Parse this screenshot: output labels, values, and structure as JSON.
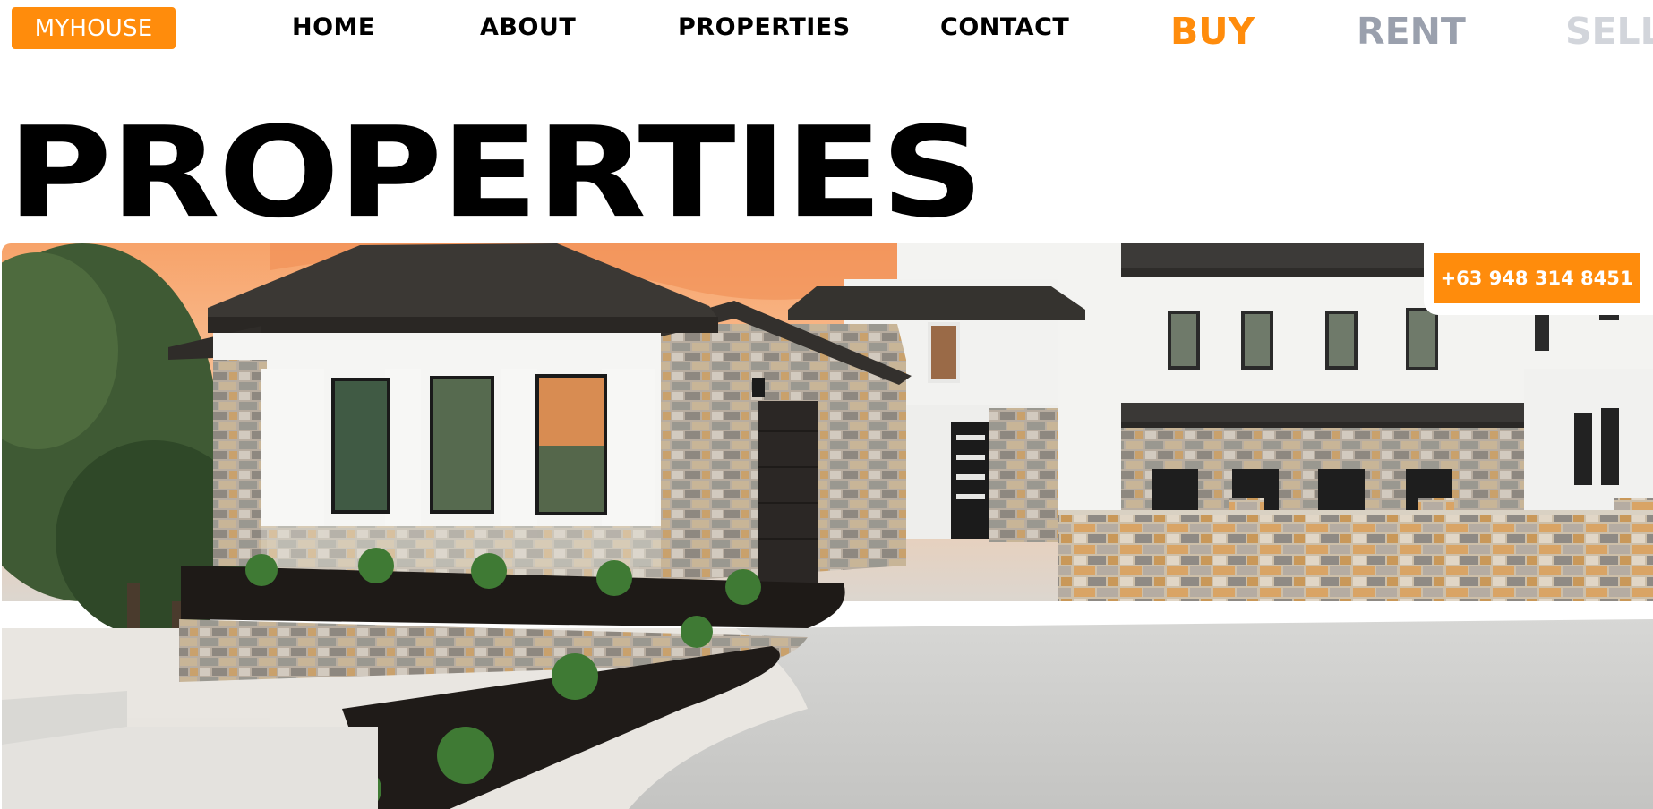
{
  "nav": {
    "logo": "MYHOUSE",
    "links": [
      "HOME",
      "ABOUT",
      "PROPERTIES",
      "CONTACT"
    ]
  },
  "modes": {
    "buy": "BUY",
    "rent": "RENT",
    "sell": "SELL"
  },
  "hero": {
    "title": "PROPERTIES",
    "phone": "+63 948 314 8451",
    "image_alt_icon": "house-photo"
  },
  "colors": {
    "accent": "#ff8c0c",
    "rent_inactive": "#9aa0ad",
    "sell_inactive": "#d2d5db",
    "text": "#000000"
  }
}
